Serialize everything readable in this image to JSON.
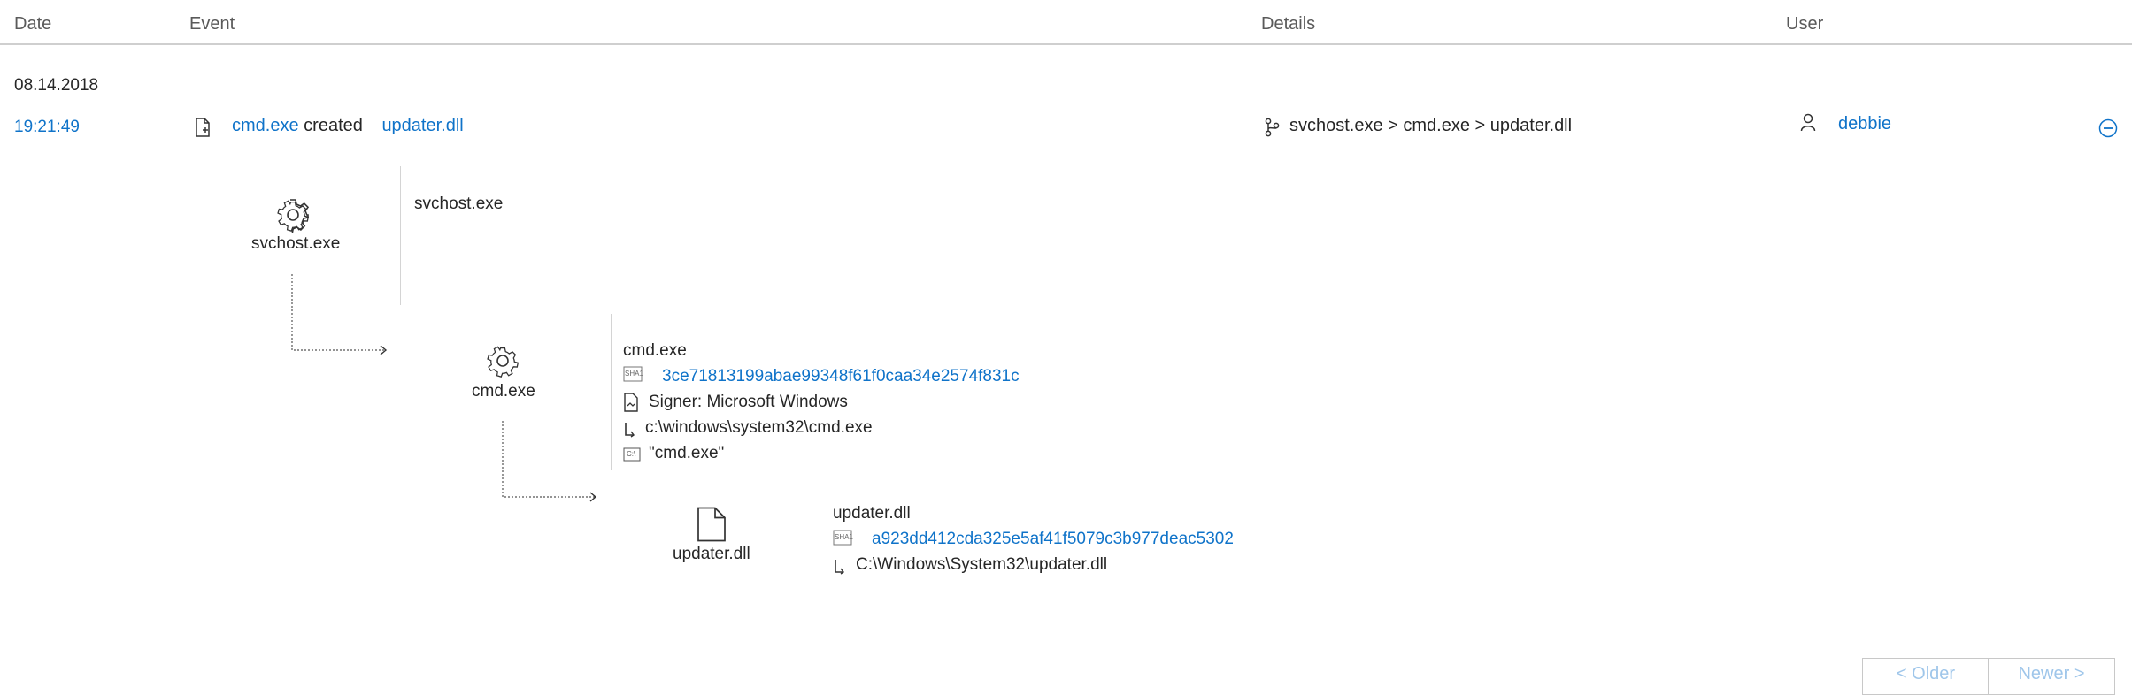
{
  "table": {
    "headers": {
      "date": "Date",
      "event": "Event",
      "details": "Details",
      "user": "User"
    }
  },
  "group": {
    "date": "08.14.2018"
  },
  "row": {
    "time": "19:21:49",
    "event": {
      "actor": "cmd.exe",
      "verb": "created",
      "target": "updater.dll"
    },
    "details": "svchost.exe > cmd.exe > updater.dll",
    "user": "debbie"
  },
  "tree": {
    "node1": {
      "icon": "gear-icon",
      "label": "svchost.exe",
      "detail_name": "svchost.exe"
    },
    "node2": {
      "icon": "gear-icon",
      "label": "cmd.exe",
      "detail_name": "cmd.exe",
      "sha1_badge": "SHA1",
      "sha1": "3ce71813199abae99348f61f0caa34e2574f831c",
      "signer": "Signer: Microsoft Windows",
      "path": "c:\\windows\\system32\\cmd.exe",
      "cmd_badge": "C:\\",
      "commandline": "\"cmd.exe\""
    },
    "node3": {
      "icon": "file-icon",
      "label": "updater.dll",
      "detail_name": "updater.dll",
      "sha1_badge": "SHA1",
      "sha1": "a923dd412cda325e5af41f5079c3b977deac5302",
      "path": "C:\\Windows\\System32\\updater.dll"
    }
  },
  "pager": {
    "older": "< Older",
    "newer": "Newer >"
  },
  "colors": {
    "link": "#0f73c9",
    "text": "#262626",
    "header": "#5a5a5a",
    "divider": "#d4d4d4"
  }
}
